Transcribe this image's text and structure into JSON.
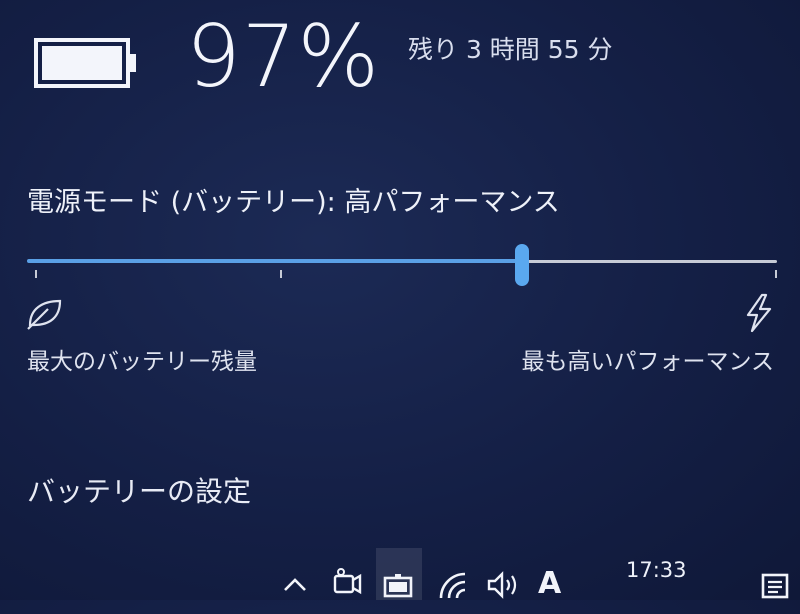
{
  "battery": {
    "percent_text": "97%",
    "level": 0.97,
    "remaining_text": "残り 3 時間 55 分"
  },
  "power_mode": {
    "label": "電源モード (バッテリー): 高パフォーマンス",
    "slider_value": 0.66,
    "left_label": "最大のバッテリー残量",
    "right_label": "最も高いパフォーマンス"
  },
  "settings": {
    "link_label": "バッテリーの設定"
  },
  "taskbar": {
    "ime_indicator": "A",
    "time": "17:33",
    "icons": [
      "chevron-up-icon",
      "meet-now-icon",
      "battery-icon",
      "wifi-icon",
      "volume-icon",
      "notification-icon"
    ]
  },
  "colors": {
    "accent": "#5aa8ef",
    "background": "#141f45"
  }
}
